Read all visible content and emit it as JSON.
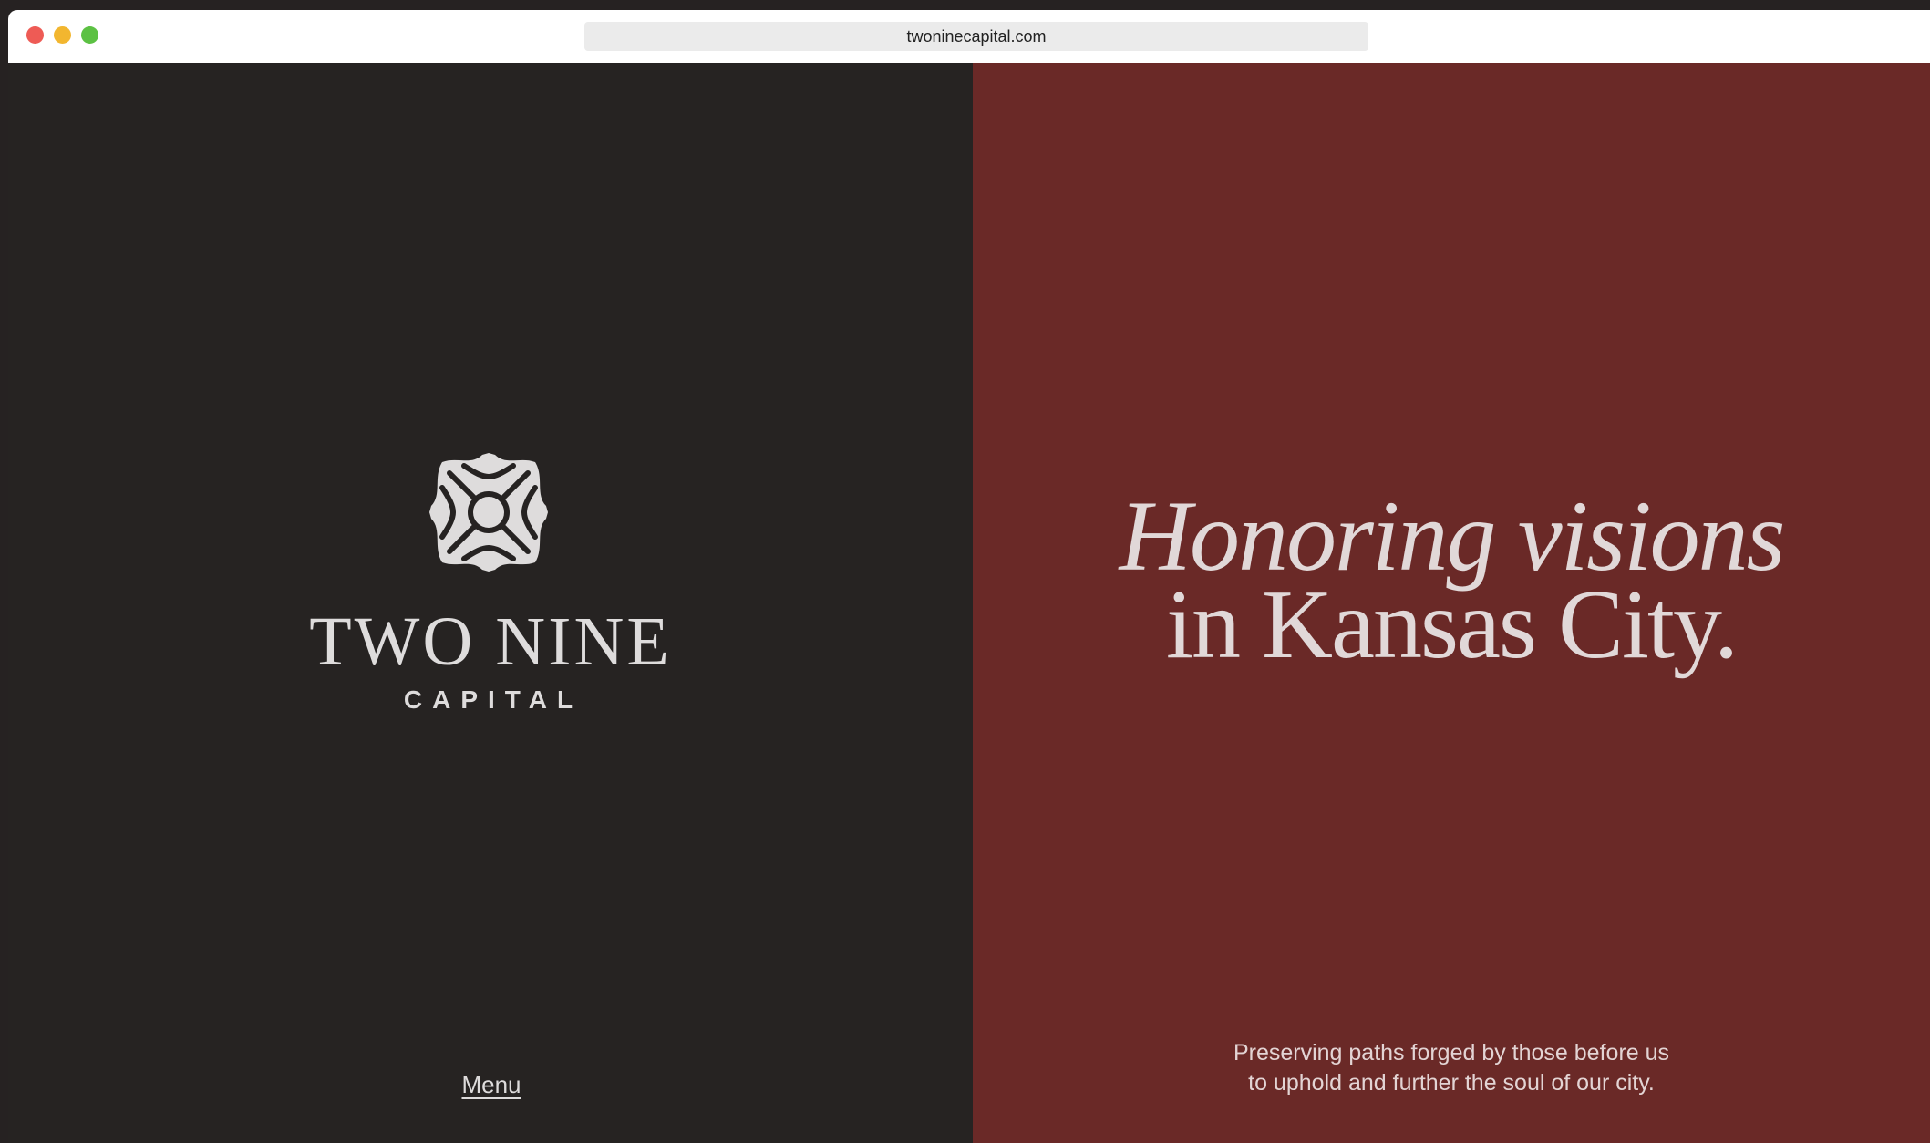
{
  "browser": {
    "url": "twoninecapital.com"
  },
  "logo": {
    "icon": "quatrefoil-emblem-icon",
    "name": "TWO NINE",
    "subtitle": "CAPITAL"
  },
  "nav": {
    "menu_label": "Menu"
  },
  "hero": {
    "line1": "Honoring visions",
    "line2": "in Kansas City."
  },
  "tagline": {
    "line1": "Preserving paths forged by those before us",
    "line2": "to uphold and further the soul of our city."
  },
  "colors": {
    "left_bg": "#262322",
    "right_bg": "#6a2927",
    "text": "#dedcdc"
  }
}
